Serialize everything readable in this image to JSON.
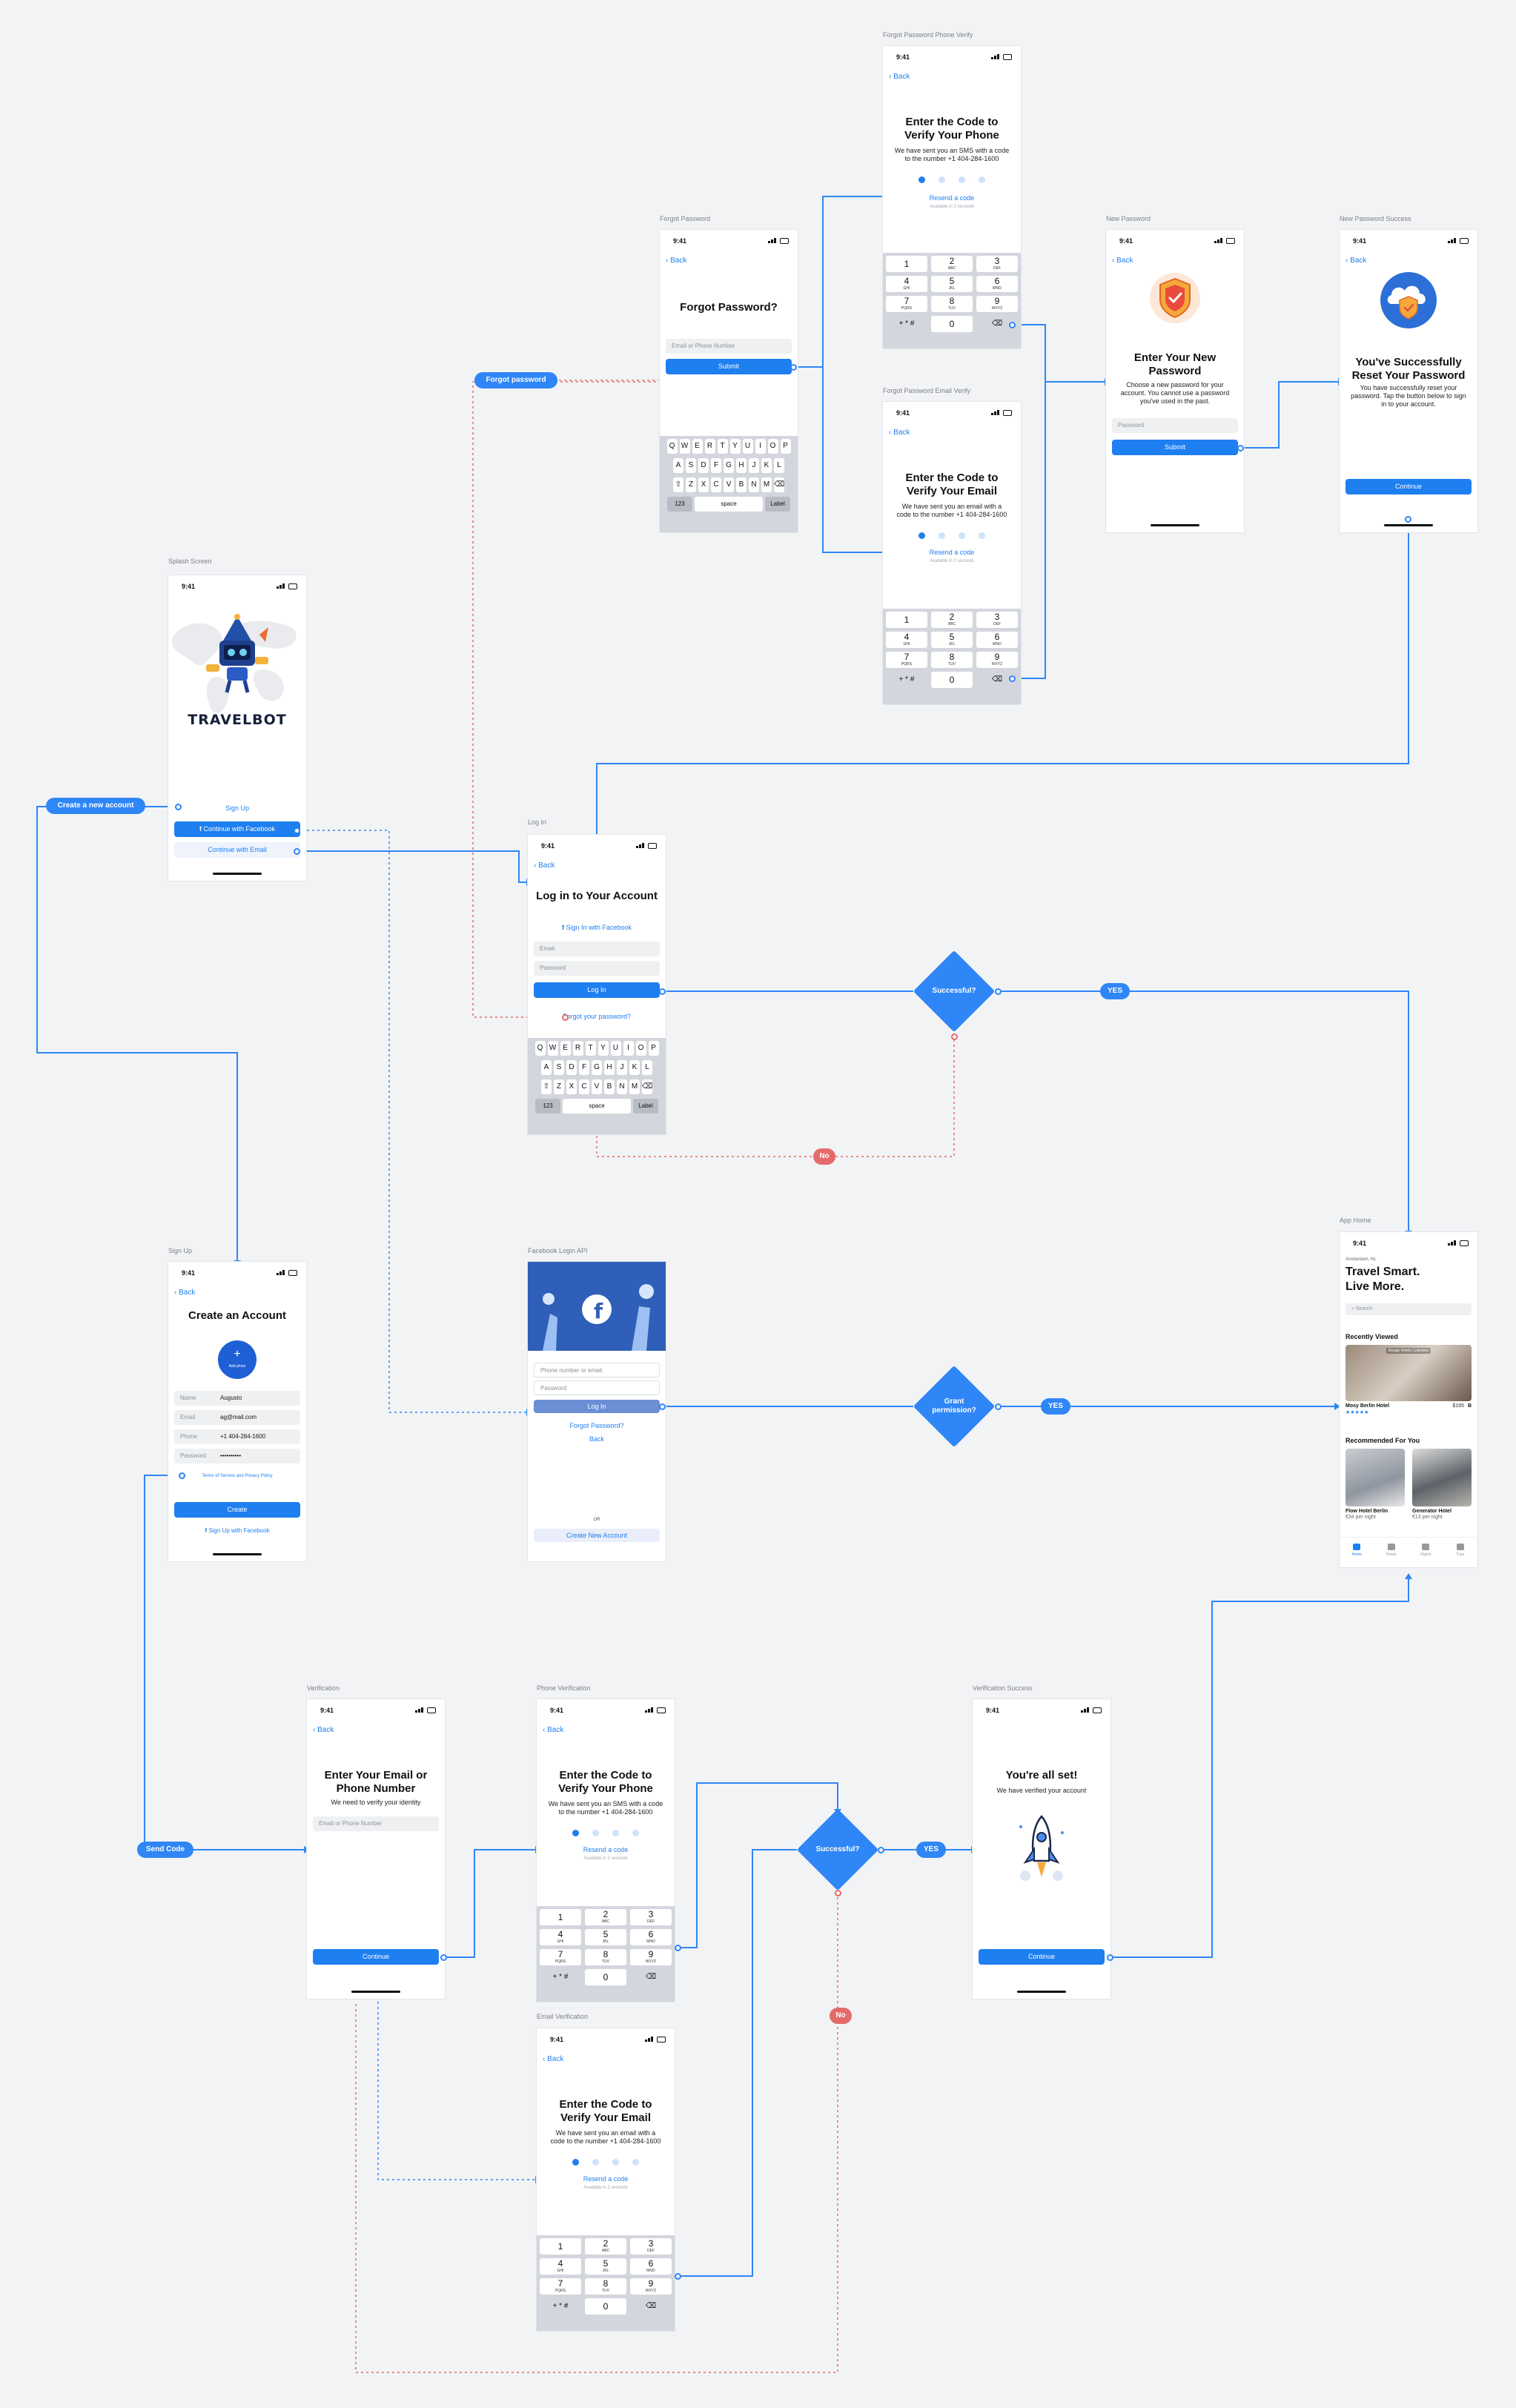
{
  "status_time": "9:41",
  "back_label": "Back",
  "frames": {
    "splash": "Splash Screen",
    "forgot": "Forgot Password",
    "fp_phone": "Forgot Password Phone Verify",
    "fp_email": "Forgot Password Email Verify",
    "new_pw": "New Password",
    "new_pw_success": "New Password Success",
    "login": "Log In",
    "signup": "Sign Up",
    "fb_api": "Facebook Login API",
    "home": "App Home",
    "verification": "Verification",
    "phone_verif": "Phone Verification",
    "email_verif": "Email Verification",
    "verif_success": "Verification Success"
  },
  "splash": {
    "logo_text": "TRAVELBOT",
    "signup_link": "Sign Up",
    "facebook_button": "Continue with Facebook",
    "email_button": "Continue with Email"
  },
  "forgot": {
    "title": "Forgot Password?",
    "input_placeholder": "Email or Phone Number",
    "submit": "Submit"
  },
  "verify_phone": {
    "title": "Enter the Code to Verify Your Phone",
    "body": "We have sent you an SMS with a code to the number +1 404-284-1600",
    "resend": "Resend a code",
    "note": "Available in 2 seconds"
  },
  "verify_email": {
    "title": "Enter the Code to Verify Your Email",
    "body": "We have sent you an email with a code to the number +1 404-284-1600",
    "resend": "Resend a code",
    "note": "Available in 2 seconds"
  },
  "numpad": [
    {
      "n": "1",
      "l": ""
    },
    {
      "n": "2",
      "l": "ABC"
    },
    {
      "n": "3",
      "l": "DEF"
    },
    {
      "n": "4",
      "l": "GHI"
    },
    {
      "n": "5",
      "l": "JKL"
    },
    {
      "n": "6",
      "l": "MNO"
    },
    {
      "n": "7",
      "l": "PQRS"
    },
    {
      "n": "8",
      "l": "TUV"
    },
    {
      "n": "9",
      "l": "WXYZ"
    },
    {
      "n": "+ * #",
      "l": ""
    },
    {
      "n": "0",
      "l": ""
    },
    {
      "n": "⌫",
      "l": ""
    }
  ],
  "keyboard": {
    "row1": [
      "Q",
      "W",
      "E",
      "R",
      "T",
      "Y",
      "U",
      "I",
      "O",
      "P"
    ],
    "row2": [
      "A",
      "S",
      "D",
      "F",
      "G",
      "H",
      "J",
      "K",
      "L"
    ],
    "row3": [
      "Z",
      "X",
      "C",
      "V",
      "B",
      "N",
      "M"
    ],
    "num_key": "123",
    "space_key": "space",
    "return_key": "Label"
  },
  "new_pw": {
    "title": "Enter Your New Password",
    "body": "Choose a new password for your account. You cannot use a password you've used in the past.",
    "input_placeholder": "Password",
    "submit": "Submit"
  },
  "new_pw_success": {
    "title": "You've Successfully Reset Your Password",
    "body": "You have successfully reset your password. Tap the button below to sign in to your account.",
    "continue": "Continue"
  },
  "login": {
    "title": "Log in to Your Account",
    "facebook_link": "Sign In with Facebook",
    "email_placeholder": "Email",
    "password_placeholder": "Password",
    "button": "Log In",
    "forgot_link": "Forgot your password?"
  },
  "signup": {
    "title": "Create an Account",
    "avatar_label": "Add photo",
    "fields": [
      {
        "k": "Name",
        "v": "Augusto"
      },
      {
        "k": "Email",
        "v": "ag@mail.com"
      },
      {
        "k": "Phone",
        "v": "+1 404-284-1600"
      },
      {
        "k": "Password",
        "v": "••••••••••"
      }
    ],
    "terms": "Terms of Service and Privacy Policy",
    "create": "Create",
    "facebook_link": "Sign Up with Facebook"
  },
  "fb_api": {
    "phone_placeholder": "Phone number or email",
    "password_placeholder": "Password",
    "login_button": "Log In",
    "forgot_link": "Forgot Password?",
    "back_link": "Back",
    "or_label": "OR",
    "create_button": "Create New Account"
  },
  "home": {
    "location": "Amsterdam, NL",
    "title_line1": "Travel Smart.",
    "title_line2": "Live More.",
    "search_placeholder": "Search",
    "recent_header": "Recently Viewed",
    "recent_tag": "Design Hotels Collection",
    "recent_name": "Mosy Berlin Hotel",
    "recent_price": "$165",
    "recent_name2": "B",
    "rec_header": "Recommended For You",
    "rec1_name": "Flow Hotel Berlin",
    "rec1_price": "€34 per night",
    "rec2_name": "Generator Hotel",
    "rec2_price": "€13 per night",
    "tabs": [
      "Home",
      "Hotels",
      "Flights",
      "Trips"
    ]
  },
  "verification": {
    "title": "Enter Your Email or Phone Number",
    "body": "We need to verify your identity",
    "input_placeholder": "Email or Phone Number",
    "continue": "Continue"
  },
  "verif_success": {
    "title": "You're all set!",
    "body": "We have verified your account",
    "continue": "Continue"
  },
  "pills": {
    "forgot_password": "Forgot password",
    "create_account": "Create a new account",
    "send_code": "Send Code",
    "yes": "YES",
    "no": "No"
  },
  "decisions": {
    "login_success": "Successful?",
    "grant": "Grant permission?",
    "verify_success": "Successful?"
  },
  "colors": {
    "accent": "#1e7ff0",
    "flow": "#2f86f6",
    "fail": "#e56a6a",
    "canvas": "#f2f3f5"
  }
}
